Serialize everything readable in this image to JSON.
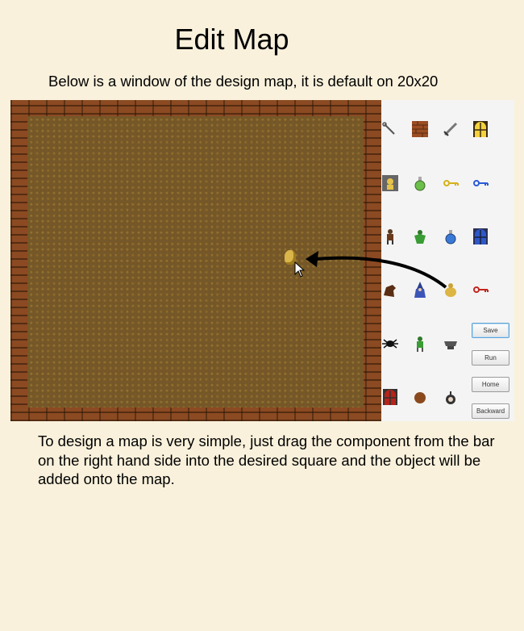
{
  "page": {
    "title": "Edit Map",
    "intro": "Below is a window of the design map, it is default on 20x20",
    "description": "To design a map is very simple, just drag the component from the bar on the right hand side into the desired square and the object will be added onto the map."
  },
  "editor": {
    "buttons": {
      "save": "Save",
      "run": "Run",
      "home": "Home",
      "backward": "Backward"
    },
    "palette_icons": [
      "wrench-icon",
      "brick-wall-icon",
      "sword-icon",
      "door-icon",
      "statue-icon",
      "green-potion-icon",
      "gold-key-icon",
      "blue-key-icon",
      "warrior-icon",
      "green-monster-icon",
      "blue-potion-icon",
      "blue-door-icon",
      "horse-icon",
      "wizard-icon",
      "gold-sack-icon",
      "red-key-icon",
      "spider-icon",
      "goblin-icon",
      "anvil-icon",
      "red-door-icon",
      "boulder-icon",
      "bomb-icon"
    ],
    "placed_item_icon": "gold-sack-icon",
    "colors": {
      "page_background": "#f9f1dc",
      "brick": "#8b4a22",
      "floor": "#75582a",
      "palette_background": "#f4f4f4",
      "focus_border": "#5fa3d8"
    }
  }
}
